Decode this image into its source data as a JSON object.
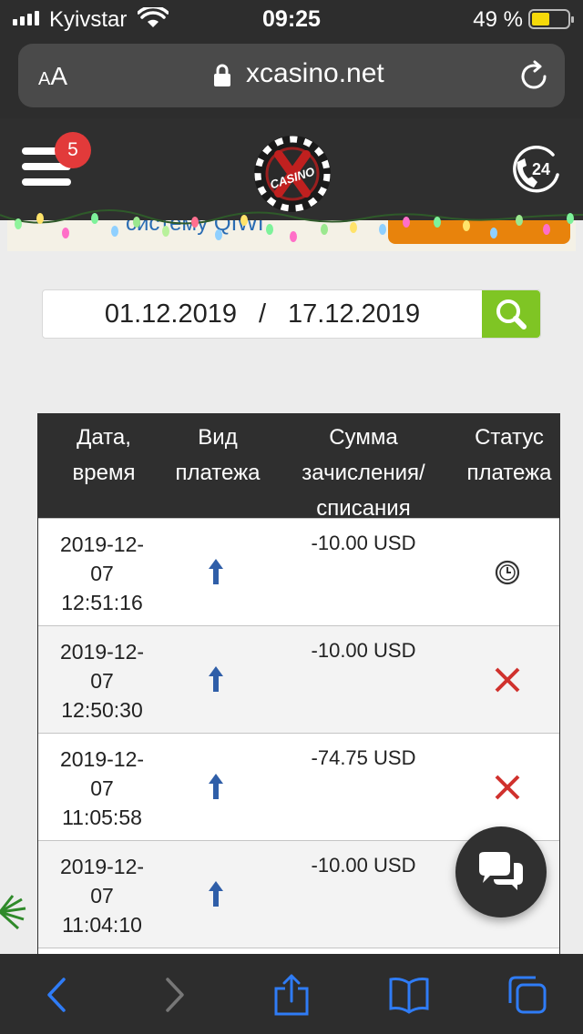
{
  "status_bar": {
    "carrier": "Kyivstar",
    "time": "09:25",
    "battery_percent": "49 %",
    "battery_level": 0.49
  },
  "browser": {
    "text_size_label": "AA",
    "url": "xcasino.net"
  },
  "site_header": {
    "menu_badge_count": "5",
    "logo_text": "CASINO",
    "support_label": "24"
  },
  "banner": {
    "partial_text": "систему QIWI"
  },
  "filter": {
    "date_from": "01.12.2019",
    "separator": "/",
    "date_to": "17.12.2019"
  },
  "table": {
    "headers": [
      "Дата,\nвремя",
      "Вид\nплатежа",
      "Сумма\nзачисления/\nсписания",
      "Статус\nплатежа"
    ],
    "rows": [
      {
        "datetime": "2019-12-\n07\n12:51:16",
        "type_icon": "arrow-up-icon",
        "amount": "-10.00 USD",
        "status_icon": "clock-icon"
      },
      {
        "datetime": "2019-12-\n07\n12:50:30",
        "type_icon": "arrow-up-icon",
        "amount": "-10.00 USD",
        "status_icon": "cross-icon"
      },
      {
        "datetime": "2019-12-\n07\n11:05:58",
        "type_icon": "arrow-up-icon",
        "amount": "-74.75 USD",
        "status_icon": "cross-icon"
      },
      {
        "datetime": "2019-12-\n07\n11:04:10",
        "type_icon": "arrow-up-icon",
        "amount": "-10.00 USD",
        "status_icon": ""
      }
    ]
  },
  "colors": {
    "header_bg": "#2f2f2f",
    "search_green": "#7fc524",
    "badge_red": "#e23a3a",
    "arrow_blue": "#2f5ea8",
    "cross_red": "#d0312d",
    "safari_blue": "#2f7cf6"
  },
  "toolbar_icons": [
    "back-icon",
    "forward-icon",
    "share-icon",
    "bookmarks-icon",
    "tabs-icon"
  ]
}
